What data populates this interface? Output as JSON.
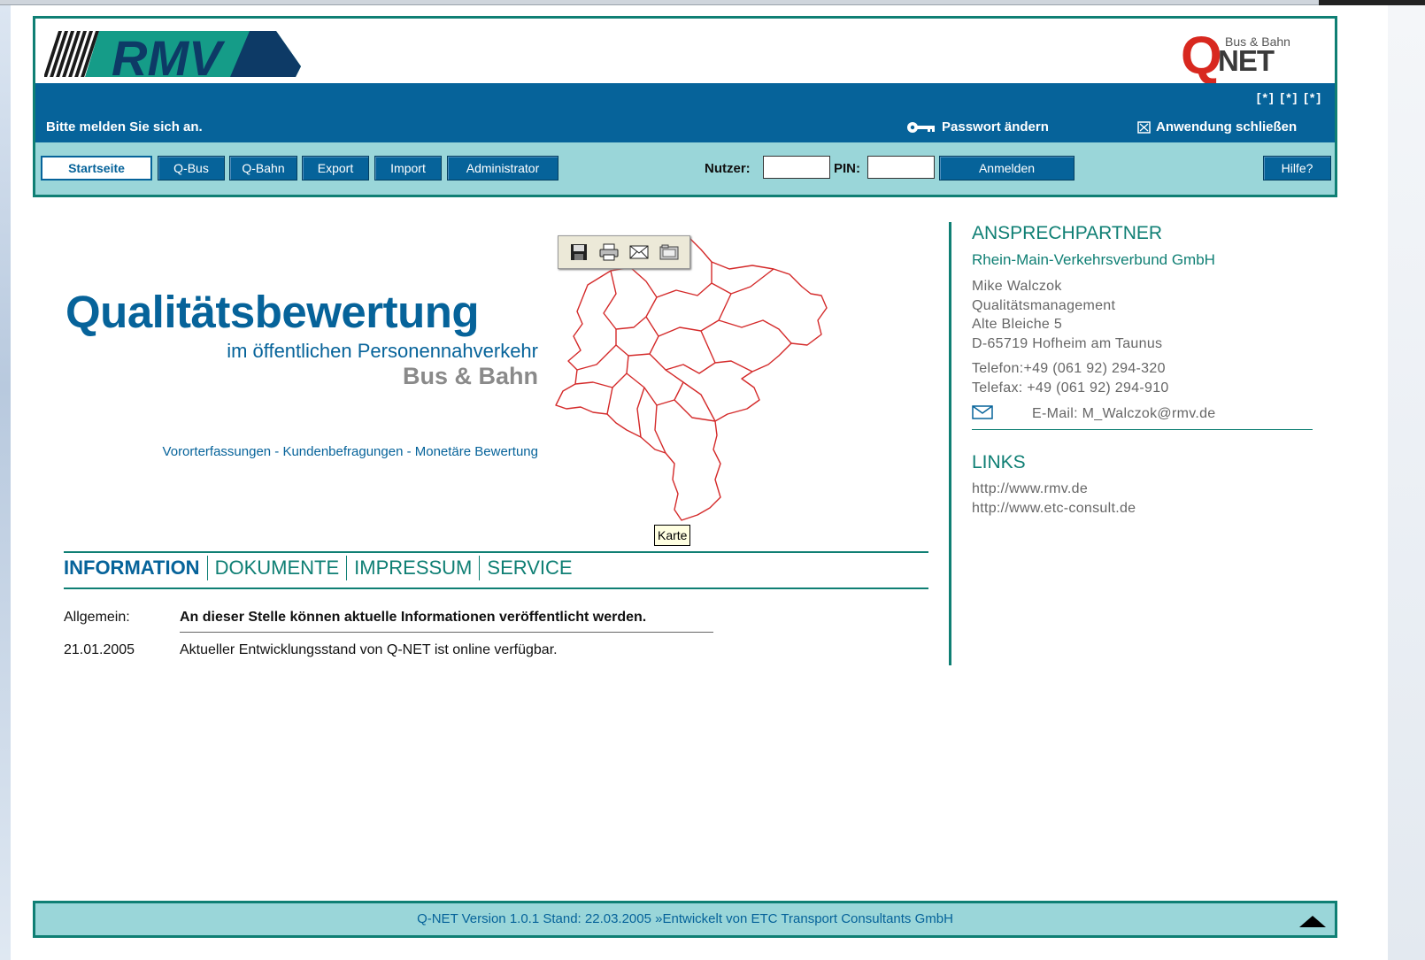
{
  "header": {
    "logo_left": "RMV",
    "logo_right": {
      "q": "Q",
      "net": "NET",
      "tagline": "Bus & Bahn"
    },
    "brackets": "[*] [*] [*]",
    "login_message": "Bitte melden Sie sich an.",
    "password_change": "Passwort ändern",
    "close_app": "Anwendung schließen"
  },
  "nav": {
    "items": [
      "Startseite",
      "Q-Bus",
      "Q-Bahn",
      "Export",
      "Import",
      "Administrator"
    ],
    "user_label": "Nutzer:",
    "pin_label": "PIN:",
    "user_value": "",
    "pin_value": "",
    "login_button": "Anmelden",
    "help_button": "Hilfe?"
  },
  "hero": {
    "title": "Qualitätsbewertung",
    "subtitle": "im öffentlichen Personennahverkehr",
    "bus_bahn": "Bus & Bahn",
    "tagline": "Vororterfassungen - Kundenbefragungen - Monetäre Bewertung"
  },
  "map": {
    "tooltip": "Karte",
    "toolbar_icons": [
      "save-icon",
      "print-icon",
      "mail-icon",
      "folder-icon"
    ]
  },
  "tabs": {
    "items": [
      "INFORMATION",
      "DOKUMENTE",
      "IMPRESSUM",
      "SERVICE"
    ],
    "active": "INFORMATION"
  },
  "info": {
    "rows": [
      {
        "label": "Allgemein:",
        "text": "An dieser Stelle können aktuelle Informationen veröffentlicht werden."
      },
      {
        "label": "21.01.2005",
        "text": "Aktueller Entwicklungsstand von Q-NET ist online verfügbar."
      }
    ]
  },
  "contact": {
    "heading": "ANSPRECHPARTNER",
    "org": "Rhein-Main-Verkehrsverbund GmbH",
    "address": [
      "Mike Walczok",
      "Qualitätsmanagement",
      "Alte Bleiche 5",
      "D-65719 Hofheim am Taunus"
    ],
    "phone": "Telefon:+49 (061 92) 294-320",
    "fax": "Telefax: +49 (061 92) 294-910",
    "email": "E-Mail: M_Walczok@rmv.de"
  },
  "links": {
    "heading": "LINKS",
    "items": [
      "http://www.rmv.de",
      "http://www.etc-consult.de"
    ]
  },
  "footer": {
    "text": "Q-NET Version 1.0.1 Stand: 22.03.2005  »Entwickelt von ETC Transport Consultants GmbH"
  },
  "colors": {
    "blue": "#06639a",
    "teal": "#0f7f74",
    "light_teal": "#9ad6d9",
    "red": "#d8281f"
  }
}
